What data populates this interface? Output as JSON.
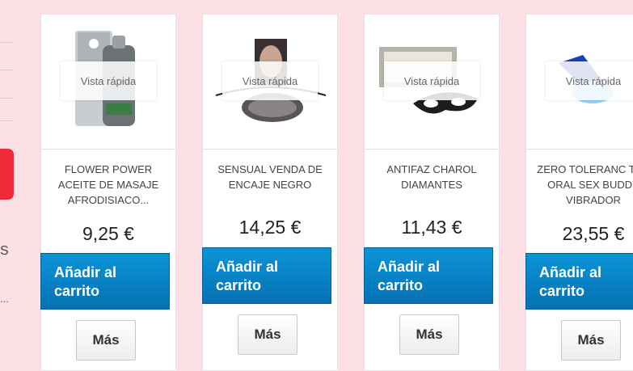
{
  "sidebar": {
    "partial_letter": "S",
    "partial_ellipsis": "..."
  },
  "products": [
    {
      "name": "FLOWER POWER ACEITE DE MASAJE AFRODISIACO...",
      "price": "9,25 €",
      "quick_view": "Vista rápida",
      "add_label": "Añadir al carrito",
      "more_label": "Más"
    },
    {
      "name": "SENSUAL VENDA DE ENCAJE NEGRO",
      "price": "14,25 €",
      "quick_view": "Vista rápida",
      "add_label": "Añadir al carrito",
      "more_label": "Más"
    },
    {
      "name": "ANTIFAZ CHAROL DIAMANTES",
      "price": "11,43 €",
      "quick_view": "Vista rápida",
      "add_label": "Añadir al carrito",
      "more_label": "Más"
    },
    {
      "name": "ZERO TOLERANC THE ORAL SEX BUDDY VIBRADOR",
      "price": "23,55 €",
      "quick_view": "Vista rápida",
      "add_label": "Añadir al carrito",
      "more_label": "Más"
    }
  ],
  "colors": {
    "page_bg": "#fde0e6",
    "button_blue": "#0a85c8",
    "sidebar_red": "#ee2b39"
  }
}
